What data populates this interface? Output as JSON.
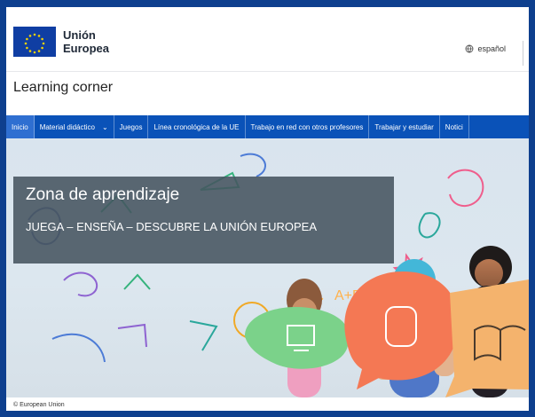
{
  "brand": {
    "line1": "Unión",
    "line2": "Europea"
  },
  "header": {
    "language": "español",
    "language_icon": "globe-icon"
  },
  "page": {
    "title": "Learning corner"
  },
  "nav": {
    "items": [
      {
        "label": "Inicio",
        "active": true
      },
      {
        "label": "Material didáctico",
        "dropdown": true
      },
      {
        "label": "Juegos"
      },
      {
        "label": "Línea cronológica de la UE"
      },
      {
        "label": "Trabajo en red con otros profesores"
      },
      {
        "label": "Trabajar y estudiar"
      },
      {
        "label": "Notici"
      }
    ]
  },
  "hero": {
    "title": "Zona de aprendizaje",
    "subtitle": "JUEGA – ENSEÑA – DESCUBRE LA UNIÓN EUROPEA"
  },
  "caption": {
    "text": "© European Union"
  },
  "colors": {
    "border": "#0e3f8e",
    "nav": "#0a52b8",
    "nav_active": "#2f6fd1",
    "hero_bg": "#d9e4ee",
    "overlay": "#465460"
  }
}
